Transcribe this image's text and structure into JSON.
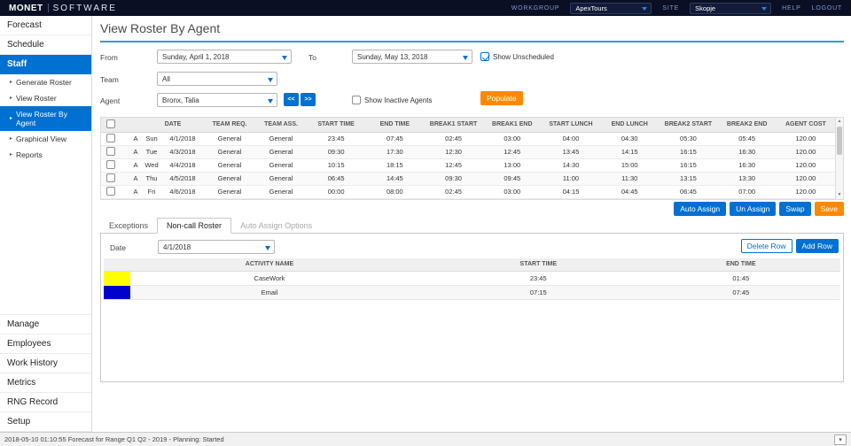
{
  "topbar": {
    "logo_primary": "MONET",
    "logo_secondary": "SOFTWARE",
    "workgroup_label": "WORKGROUP",
    "workgroup_value": "ApexTours",
    "site_label": "SITE",
    "site_value": "Skopje",
    "help_label": "HELP",
    "logout_label": "LOGOUT"
  },
  "sidebar": {
    "main_items": [
      {
        "label": "Forecast",
        "active": false
      },
      {
        "label": "Schedule",
        "active": false
      },
      {
        "label": "Staff",
        "active": true
      }
    ],
    "staff_subitems": [
      {
        "label": "Generate Roster",
        "active": false
      },
      {
        "label": "View Roster",
        "active": false
      },
      {
        "label": "View Roster By Agent",
        "active": true
      },
      {
        "label": "Graphical View",
        "active": false
      },
      {
        "label": "Reports",
        "active": false
      }
    ],
    "bottom_items": [
      {
        "label": "Manage"
      },
      {
        "label": "Employees"
      },
      {
        "label": "Work History"
      },
      {
        "label": "Metrics"
      },
      {
        "label": "RNG Record"
      },
      {
        "label": "Setup"
      }
    ]
  },
  "page": {
    "title": "View Roster By Agent"
  },
  "filters": {
    "from_label": "From",
    "from_value": "Sunday, April 1, 2018",
    "to_label": "To",
    "to_value": "Sunday, May 13, 2018",
    "show_unscheduled": {
      "label": "Show Unscheduled",
      "checked": true
    },
    "team_label": "Team",
    "team_value": "All",
    "agent_label": "Agent",
    "agent_value": "Bronx, Talia",
    "prev_agent_label": "<<",
    "next_agent_label": ">>",
    "show_inactive": {
      "label": "Show Inactive Agents",
      "checked": false
    },
    "populate_label": "Populate"
  },
  "roster": {
    "headers": [
      "DATE",
      "TEAM REQ.",
      "TEAM ASS.",
      "START TIME",
      "END TIME",
      "BREAK1 START",
      "BREAK1 END",
      "START LUNCH",
      "END LUNCH",
      "BREAK2 START",
      "BREAK2 END",
      "AGENT COST"
    ],
    "rows": [
      {
        "flag": "A",
        "day": "Sun",
        "date": "4/1/2018",
        "team_req": "General",
        "team_ass": "General",
        "start_time": "23:45",
        "end_time": "07:45",
        "break1_start": "02:45",
        "break1_end": "03:00",
        "start_lunch": "04:00",
        "end_lunch": "04:30",
        "break2_start": "05:30",
        "break2_end": "05:45",
        "agent_cost": "120.00"
      },
      {
        "flag": "A",
        "day": "Tue",
        "date": "4/3/2018",
        "team_req": "General",
        "team_ass": "General",
        "start_time": "09:30",
        "end_time": "17:30",
        "break1_start": "12:30",
        "break1_end": "12:45",
        "start_lunch": "13:45",
        "end_lunch": "14:15",
        "break2_start": "16:15",
        "break2_end": "16:30",
        "agent_cost": "120.00"
      },
      {
        "flag": "A",
        "day": "Wed",
        "date": "4/4/2018",
        "team_req": "General",
        "team_ass": "General",
        "start_time": "10:15",
        "end_time": "18:15",
        "break1_start": "12:45",
        "break1_end": "13:00",
        "start_lunch": "14:30",
        "end_lunch": "15:00",
        "break2_start": "16:15",
        "break2_end": "16:30",
        "agent_cost": "120.00"
      },
      {
        "flag": "A",
        "day": "Thu",
        "date": "4/5/2018",
        "team_req": "General",
        "team_ass": "General",
        "start_time": "06:45",
        "end_time": "14:45",
        "break1_start": "09:30",
        "break1_end": "09:45",
        "start_lunch": "11:00",
        "end_lunch": "11:30",
        "break2_start": "13:15",
        "break2_end": "13:30",
        "agent_cost": "120.00"
      },
      {
        "flag": "A",
        "day": "Fri",
        "date": "4/6/2018",
        "team_req": "General",
        "team_ass": "General",
        "start_time": "00:00",
        "end_time": "08:00",
        "break1_start": "02:45",
        "break1_end": "03:00",
        "start_lunch": "04:15",
        "end_lunch": "04:45",
        "break2_start": "06:45",
        "break2_end": "07:00",
        "agent_cost": "120.00"
      }
    ]
  },
  "actions": {
    "auto_assign_label": "Auto Assign",
    "un_assign_label": "Un Assign",
    "swap_label": "Swap",
    "save_label": "Save"
  },
  "tabs": [
    {
      "label": "Exceptions",
      "active": false
    },
    {
      "label": "Non-call Roster",
      "active": true
    },
    {
      "label": "Auto Assign Options",
      "active": false,
      "muted": true
    }
  ],
  "noncall": {
    "date_label": "Date",
    "date_value": "4/1/2018",
    "delete_row_label": "Delete Row",
    "add_row_label": "Add Row",
    "headers": [
      "ACTIVITY NAME",
      "START TIME",
      "END TIME"
    ],
    "rows": [
      {
        "color": "#ffff00",
        "activity": "CaseWork",
        "start_time": "23:45",
        "end_time": "01:45"
      },
      {
        "color": "#0000cc",
        "activity": "Email",
        "start_time": "07:15",
        "end_time": "07:45"
      }
    ]
  },
  "statusbar": {
    "text": "2018-05-10 01:10:55 Forecast for Range Q1 Q2 - 2019 - Planning: Started"
  },
  "icons": {
    "nav_arrow": "▸",
    "scroll_up": "▲",
    "scroll_down": "▼",
    "status_caret": "▾"
  },
  "colors": {
    "accent_blue": "#0070d2",
    "accent_orange": "#ff8800",
    "topbar_bg": "#0a0f24"
  }
}
